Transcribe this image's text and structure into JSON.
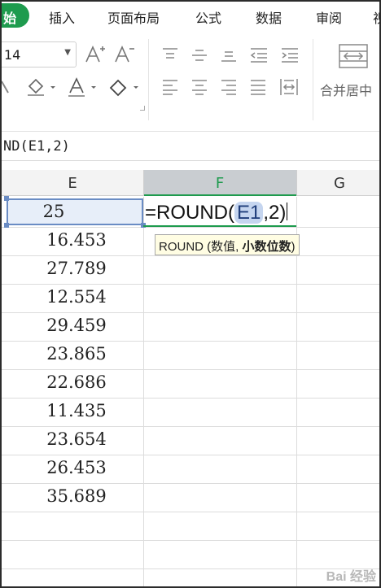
{
  "ribbon_tabs": {
    "active": "始",
    "items": [
      "插入",
      "页面布局",
      "公式",
      "数据",
      "审阅",
      "视"
    ]
  },
  "ribbon": {
    "font_size": "14",
    "merge_label": "合并居中"
  },
  "formula_bar": {
    "text": "ND(E1,2)"
  },
  "columns": {
    "E": "E",
    "F": "F",
    "G": "G"
  },
  "cells": {
    "E": [
      "25",
      "16.453",
      "27.789",
      "12.554",
      "29.459",
      "23.865",
      "22.686",
      "11.435",
      "23.654",
      "26.453",
      "35.689"
    ]
  },
  "editing": {
    "prefix": "=ROUND(",
    "ref": "E1",
    "suffix": ",2)"
  },
  "tooltip": {
    "normal": "ROUND (数值,",
    "bold": "小数位数",
    "close": ")"
  },
  "watermark": "Bai 经验",
  "colors": {
    "accent": "#1e9b4e",
    "selection": "#6a8cc4"
  }
}
